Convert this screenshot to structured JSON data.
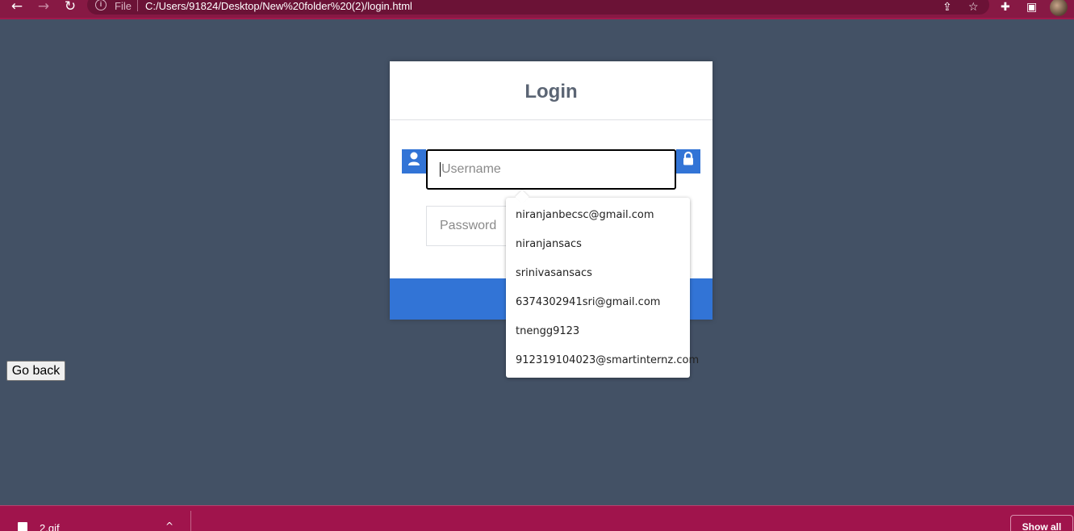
{
  "browser": {
    "scheme_label": "File",
    "url": "C:/Users/91824/Desktop/New%20folder%20(2)/login.html",
    "icons": [
      "back-arrow-icon",
      "forward-arrow-icon",
      "reload-icon",
      "info-icon",
      "share-icon",
      "star-icon",
      "extensions-icon",
      "side-panel-icon"
    ]
  },
  "login": {
    "title": "Login",
    "username_placeholder": "Username",
    "password_placeholder": "Password",
    "accent_color": "#3274d6"
  },
  "autofill": {
    "options": [
      "niranjanbecsc@gmail.com",
      "niranjansacs",
      "srinivasansacs",
      "6374302941sri@gmail.com",
      "tnengg9123",
      "912319104023@smartinternz.com"
    ]
  },
  "page": {
    "go_back_label": "Go back",
    "background_color": "#435165"
  },
  "downloads": {
    "file_name": "2.gif",
    "show_all_label": "Show all"
  }
}
